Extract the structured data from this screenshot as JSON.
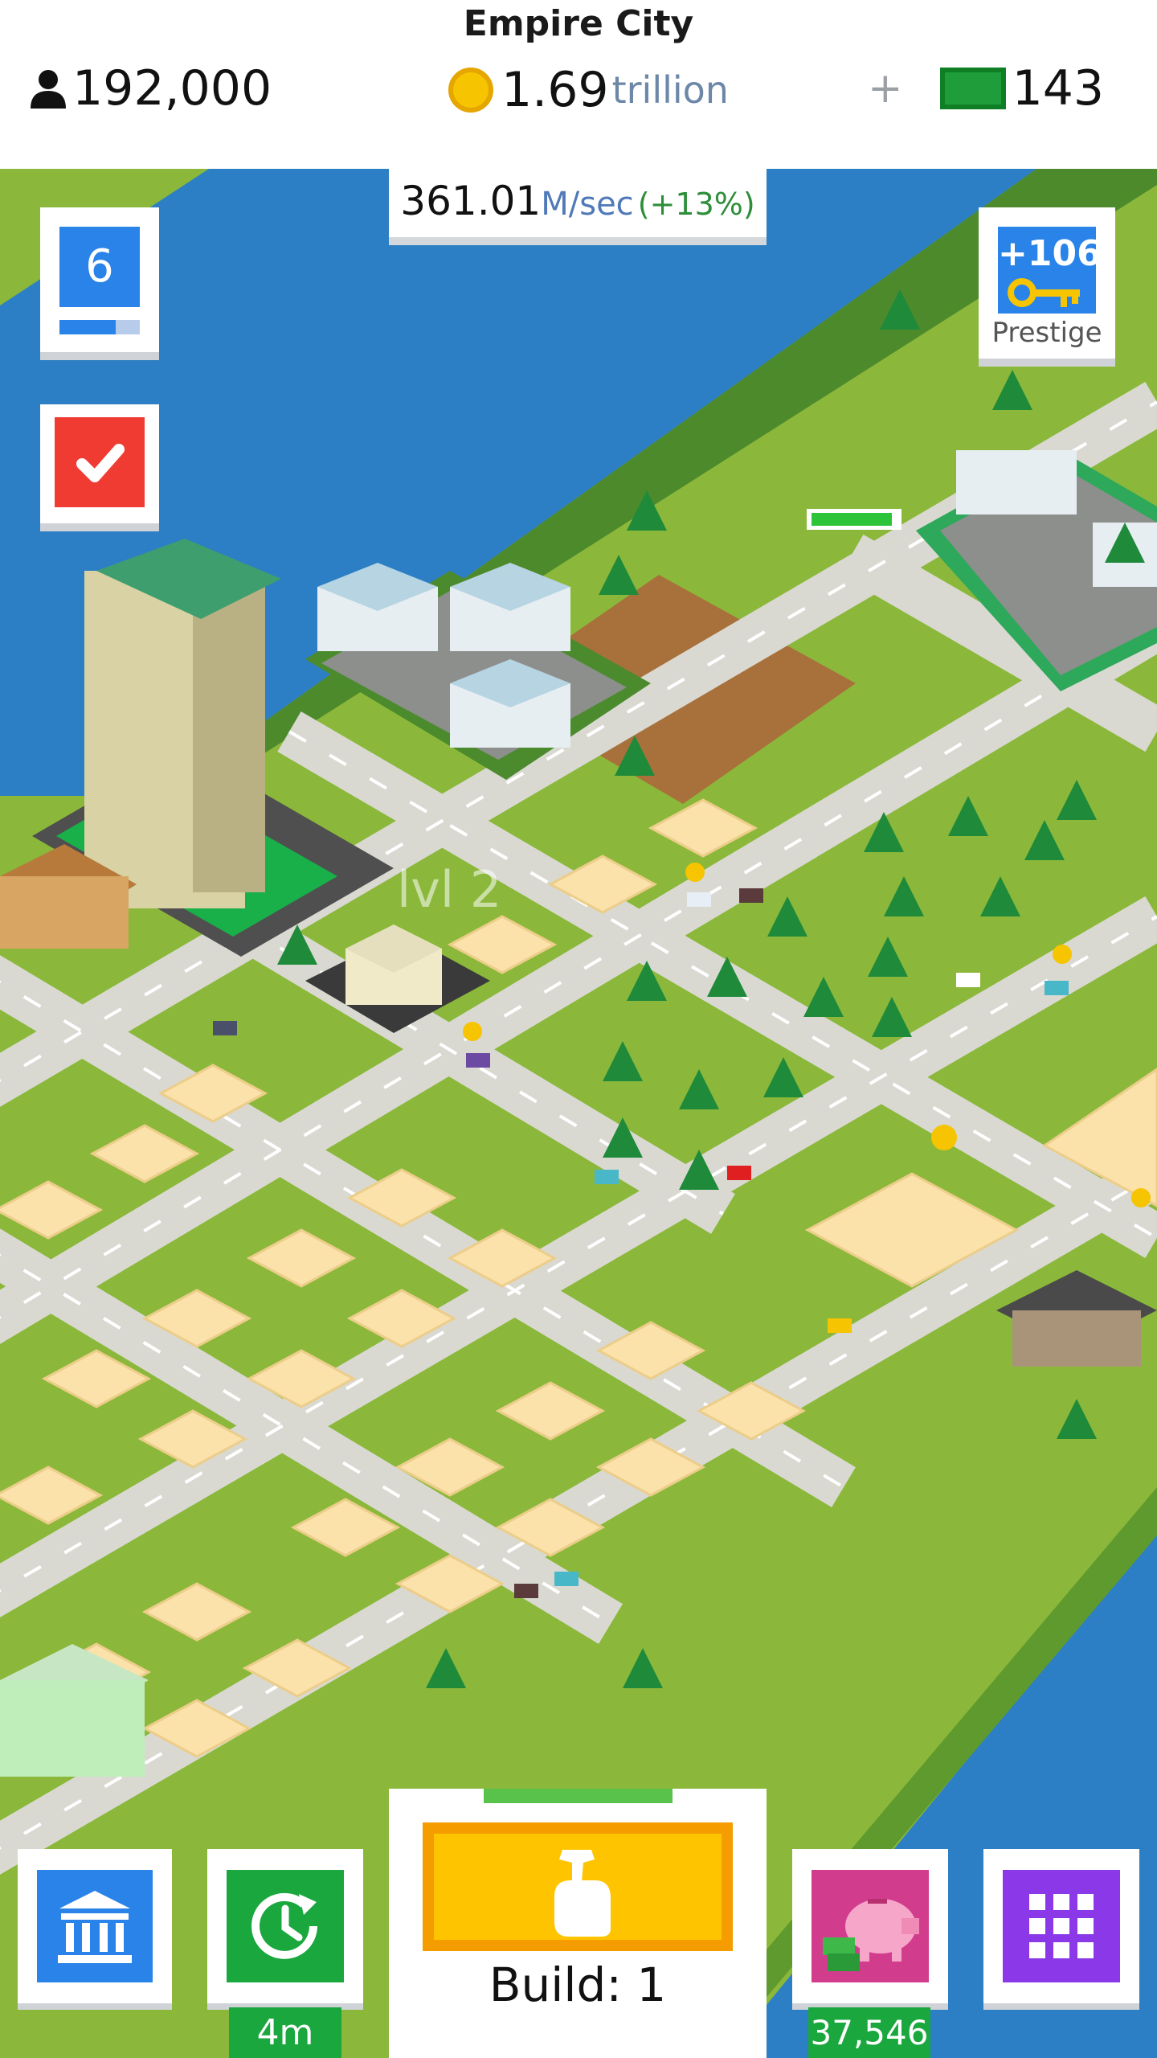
{
  "header": {
    "city_name": "Empire City",
    "population": "192,000",
    "money_value": "1.69",
    "money_unit": "trillion",
    "plus": "+",
    "cash": "143"
  },
  "income": {
    "value": "361.01",
    "unit": "M/sec",
    "bonus": "(+13%)"
  },
  "level_card": {
    "level": "6",
    "progress": 0.7
  },
  "prestige": {
    "value": "+106",
    "label": "Prestige"
  },
  "map_label": "lvl 2",
  "build": {
    "label": "Build: 1",
    "progress": 0.5
  },
  "boost": {
    "timer": "4m"
  },
  "piggy": {
    "value": "37,546"
  },
  "colors": {
    "grass": "#8bb83a",
    "water": "#2c7fc4",
    "road": "#d9d9d2",
    "lot": "#fbe2aa",
    "dirt": "#a8713b",
    "tree": "#1f8a3a",
    "blue_button": "#2a83e8",
    "green_button": "#1aa73e",
    "red_button": "#f03b32",
    "purple_button": "#8b38e8",
    "pink_button": "#d23c8d",
    "build_yellow": "#ffc400"
  },
  "icons": {
    "population": "person-icon",
    "money": "coin-icon",
    "cash": "banknote-icon",
    "task": "checkmark-icon",
    "prestige": "key-icon",
    "build": "hammer-hand-icon",
    "bank": "bank-icon",
    "boost": "clock-arrow-icon",
    "piggy": "piggy-bank-icon",
    "menu": "grid-icon"
  }
}
